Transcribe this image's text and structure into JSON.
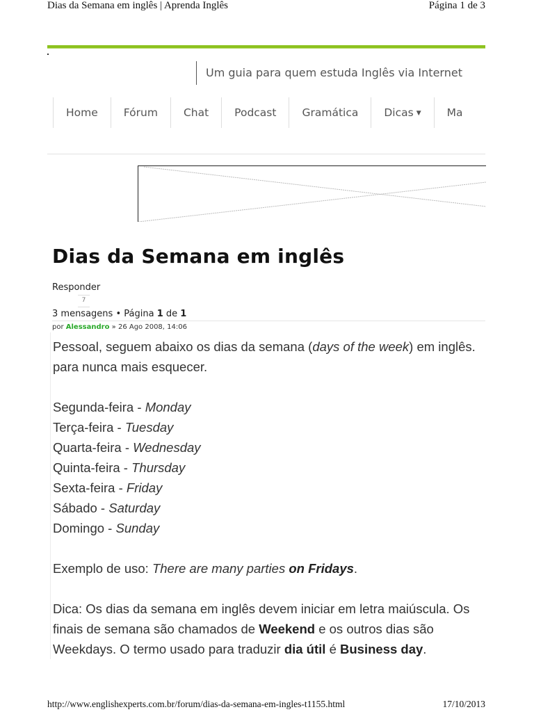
{
  "print_header": {
    "title": "Dias da Semana em inglês | Aprenda Inglês",
    "page_indicator": "Página 1 de 3"
  },
  "site": {
    "tagline": "Um guia para quem estuda Inglês via Internet",
    "brand_color": "#8dc21f"
  },
  "nav": {
    "items": [
      {
        "label": "Home"
      },
      {
        "label": "Fórum"
      },
      {
        "label": "Chat"
      },
      {
        "label": "Podcast"
      },
      {
        "label": "Gramática"
      },
      {
        "label": "Dicas",
        "has_dropdown": true,
        "icon": "caret-down-icon"
      },
      {
        "label": "Ma"
      }
    ],
    "dropdown_glyph": "▼"
  },
  "banner": {
    "icon": "broken-image-placeholder-icon"
  },
  "topic": {
    "title": "Dias da Semana em inglês",
    "reply_label": "Responder",
    "reply_count": "7",
    "messages_text": "3 mensagens",
    "bullet": "•",
    "page_word": "Página",
    "page_current": "1",
    "page_of": "de",
    "page_total": "1"
  },
  "post": {
    "by_label": "por",
    "author": "Alessandro",
    "separator": "»",
    "datetime": "26 Ago 2008, 14:06",
    "intro_part1": "Pessoal, seguem abaixo os dias da semana (",
    "intro_italic": "days of the week",
    "intro_part2": ") em inglês. para nunca mais esquecer.",
    "days": [
      {
        "pt": "Segunda-feira",
        "en": "Monday"
      },
      {
        "pt": "Terça-feira",
        "en": "Tuesday"
      },
      {
        "pt": "Quarta-feira",
        "en": "Wednesday"
      },
      {
        "pt": "Quinta-feira",
        "en": "Thursday"
      },
      {
        "pt": "Sexta-feira",
        "en": "Friday"
      },
      {
        "pt": "Sábado",
        "en": "Saturday"
      },
      {
        "pt": "Domingo",
        "en": "Sunday"
      }
    ],
    "day_separator": " - ",
    "example_label": "Exemplo de uso: ",
    "example_italic": "There are many parties ",
    "example_bold": "on Fridays",
    "example_end": ".",
    "tip_part1": "Dica: Os dias da semana em inglês devem iniciar em letra maiúscula. Os finais de semana são chamados de ",
    "tip_bold1": "Weekend",
    "tip_part2": " e os outros dias são Weekdays. O termo usado para traduzir ",
    "tip_bold2": "dia útil",
    "tip_part3": " é ",
    "tip_bold3": "Business day",
    "tip_end": "."
  },
  "print_footer": {
    "url": "http://www.englishexperts.com.br/forum/dias-da-semana-em-ingles-t1155.html",
    "date": "17/10/2013"
  }
}
